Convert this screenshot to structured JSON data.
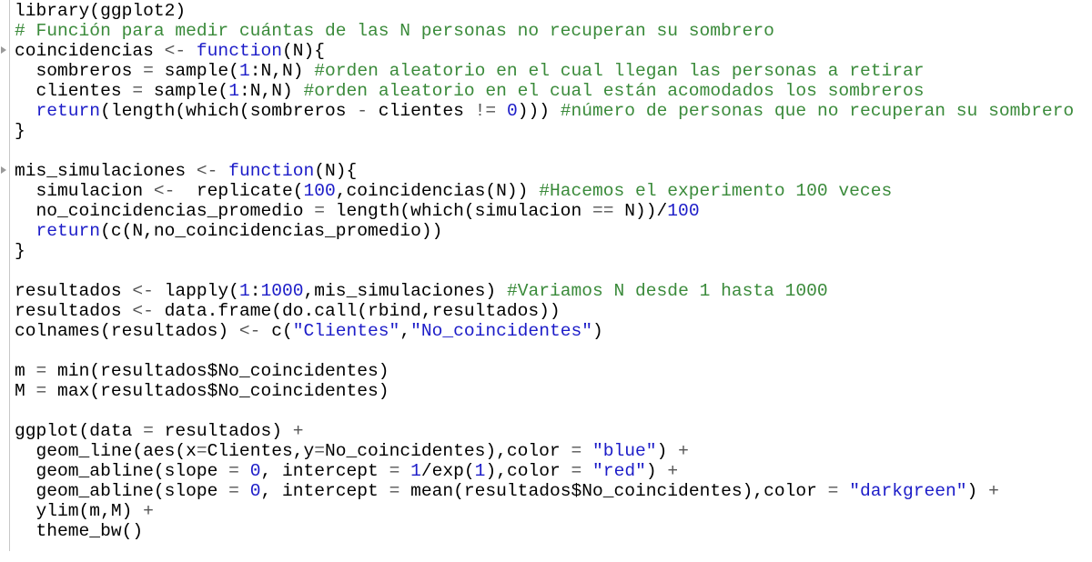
{
  "editor": {
    "lines": [
      [
        {
          "t": "library(ggplot2)",
          "c": "tx"
        }
      ],
      [
        {
          "t": "# Función para medir cuántas de las N personas no recuperan su sombrero",
          "c": "cm"
        }
      ],
      [
        {
          "t": "coincidencias ",
          "c": "tx"
        },
        {
          "t": "<-",
          "c": "op"
        },
        {
          "t": " function",
          "c": "kw"
        },
        {
          "t": "(N){",
          "c": "tx"
        }
      ],
      [
        {
          "t": "  sombreros ",
          "c": "tx"
        },
        {
          "t": "=",
          "c": "op"
        },
        {
          "t": " sample(",
          "c": "tx"
        },
        {
          "t": "1",
          "c": "nm"
        },
        {
          "t": ":N,N) ",
          "c": "tx"
        },
        {
          "t": "#orden aleatorio en el cual llegan las personas a retirar",
          "c": "cm"
        }
      ],
      [
        {
          "t": "  clientes ",
          "c": "tx"
        },
        {
          "t": "=",
          "c": "op"
        },
        {
          "t": " sample(",
          "c": "tx"
        },
        {
          "t": "1",
          "c": "nm"
        },
        {
          "t": ":N,N) ",
          "c": "tx"
        },
        {
          "t": "#orden aleatorio en el cual están acomodados los sombreros",
          "c": "cm"
        }
      ],
      [
        {
          "t": "  return",
          "c": "kw"
        },
        {
          "t": "(length(which(sombreros ",
          "c": "tx"
        },
        {
          "t": "-",
          "c": "op"
        },
        {
          "t": " clientes ",
          "c": "tx"
        },
        {
          "t": "!=",
          "c": "op"
        },
        {
          "t": " ",
          "c": "tx"
        },
        {
          "t": "0",
          "c": "nm"
        },
        {
          "t": "))) ",
          "c": "tx"
        },
        {
          "t": "#número de personas que no recuperan su sombrero",
          "c": "cm"
        }
      ],
      [
        {
          "t": "}",
          "c": "tx"
        }
      ],
      [
        {
          "t": "",
          "c": "tx"
        }
      ],
      [
        {
          "t": "mis_simulaciones ",
          "c": "tx"
        },
        {
          "t": "<-",
          "c": "op"
        },
        {
          "t": " function",
          "c": "kw"
        },
        {
          "t": "(N){",
          "c": "tx"
        }
      ],
      [
        {
          "t": "  simulacion ",
          "c": "tx"
        },
        {
          "t": "<-",
          "c": "op"
        },
        {
          "t": "  replicate(",
          "c": "tx"
        },
        {
          "t": "100",
          "c": "nm"
        },
        {
          "t": ",coincidencias(N)) ",
          "c": "tx"
        },
        {
          "t": "#Hacemos el experimento 100 veces",
          "c": "cm"
        }
      ],
      [
        {
          "t": "  no_coincidencias_promedio ",
          "c": "tx"
        },
        {
          "t": "=",
          "c": "op"
        },
        {
          "t": " length(which(simulacion ",
          "c": "tx"
        },
        {
          "t": "==",
          "c": "op"
        },
        {
          "t": " N))/",
          "c": "tx"
        },
        {
          "t": "100",
          "c": "nm"
        }
      ],
      [
        {
          "t": "  return",
          "c": "kw"
        },
        {
          "t": "(c(N,no_coincidencias_promedio))",
          "c": "tx"
        }
      ],
      [
        {
          "t": "}",
          "c": "tx"
        }
      ],
      [
        {
          "t": "",
          "c": "tx"
        }
      ],
      [
        {
          "t": "resultados ",
          "c": "tx"
        },
        {
          "t": "<-",
          "c": "op"
        },
        {
          "t": " lapply(",
          "c": "tx"
        },
        {
          "t": "1",
          "c": "nm"
        },
        {
          "t": ":",
          "c": "tx"
        },
        {
          "t": "1000",
          "c": "nm"
        },
        {
          "t": ",mis_simulaciones) ",
          "c": "tx"
        },
        {
          "t": "#Variamos N desde 1 hasta 1000",
          "c": "cm"
        }
      ],
      [
        {
          "t": "resultados ",
          "c": "tx"
        },
        {
          "t": "<-",
          "c": "op"
        },
        {
          "t": " data.frame(do.call(rbind,resultados))",
          "c": "tx"
        }
      ],
      [
        {
          "t": "colnames(resultados) ",
          "c": "tx"
        },
        {
          "t": "<-",
          "c": "op"
        },
        {
          "t": " c(",
          "c": "tx"
        },
        {
          "t": "\"Clientes\"",
          "c": "st"
        },
        {
          "t": ",",
          "c": "tx"
        },
        {
          "t": "\"No_coincidentes\"",
          "c": "st"
        },
        {
          "t": ")",
          "c": "tx"
        }
      ],
      [
        {
          "t": "",
          "c": "tx"
        }
      ],
      [
        {
          "t": "m ",
          "c": "tx"
        },
        {
          "t": "=",
          "c": "op"
        },
        {
          "t": " min(resultados$No_coincidentes)",
          "c": "tx"
        }
      ],
      [
        {
          "t": "M ",
          "c": "tx"
        },
        {
          "t": "=",
          "c": "op"
        },
        {
          "t": " max(resultados$No_coincidentes)",
          "c": "tx"
        }
      ],
      [
        {
          "t": "",
          "c": "tx"
        }
      ],
      [
        {
          "t": "ggplot(data ",
          "c": "tx"
        },
        {
          "t": "=",
          "c": "op"
        },
        {
          "t": " resultados) ",
          "c": "tx"
        },
        {
          "t": "+",
          "c": "op"
        }
      ],
      [
        {
          "t": "  geom_line(aes(x",
          "c": "tx"
        },
        {
          "t": "=",
          "c": "op"
        },
        {
          "t": "Clientes,y",
          "c": "tx"
        },
        {
          "t": "=",
          "c": "op"
        },
        {
          "t": "No_coincidentes),color ",
          "c": "tx"
        },
        {
          "t": "=",
          "c": "op"
        },
        {
          "t": " ",
          "c": "tx"
        },
        {
          "t": "\"blue\"",
          "c": "st"
        },
        {
          "t": ") ",
          "c": "tx"
        },
        {
          "t": "+",
          "c": "op"
        }
      ],
      [
        {
          "t": "  geom_abline(slope ",
          "c": "tx"
        },
        {
          "t": "=",
          "c": "op"
        },
        {
          "t": " ",
          "c": "tx"
        },
        {
          "t": "0",
          "c": "nm"
        },
        {
          "t": ", intercept ",
          "c": "tx"
        },
        {
          "t": "=",
          "c": "op"
        },
        {
          "t": " ",
          "c": "tx"
        },
        {
          "t": "1",
          "c": "nm"
        },
        {
          "t": "/exp(",
          "c": "tx"
        },
        {
          "t": "1",
          "c": "nm"
        },
        {
          "t": "),color ",
          "c": "tx"
        },
        {
          "t": "=",
          "c": "op"
        },
        {
          "t": " ",
          "c": "tx"
        },
        {
          "t": "\"red\"",
          "c": "st"
        },
        {
          "t": ") ",
          "c": "tx"
        },
        {
          "t": "+",
          "c": "op"
        }
      ],
      [
        {
          "t": "  geom_abline(slope ",
          "c": "tx"
        },
        {
          "t": "=",
          "c": "op"
        },
        {
          "t": " ",
          "c": "tx"
        },
        {
          "t": "0",
          "c": "nm"
        },
        {
          "t": ", intercept ",
          "c": "tx"
        },
        {
          "t": "=",
          "c": "op"
        },
        {
          "t": " mean(resultados$No_coincidentes),color ",
          "c": "tx"
        },
        {
          "t": "=",
          "c": "op"
        },
        {
          "t": " ",
          "c": "tx"
        },
        {
          "t": "\"darkgreen\"",
          "c": "st"
        },
        {
          "t": ") ",
          "c": "tx"
        },
        {
          "t": "+",
          "c": "op"
        }
      ],
      [
        {
          "t": "  ylim(m,M) ",
          "c": "tx"
        },
        {
          "t": "+",
          "c": "op"
        }
      ],
      [
        {
          "t": "  theme_bw()",
          "c": "tx"
        }
      ]
    ]
  }
}
